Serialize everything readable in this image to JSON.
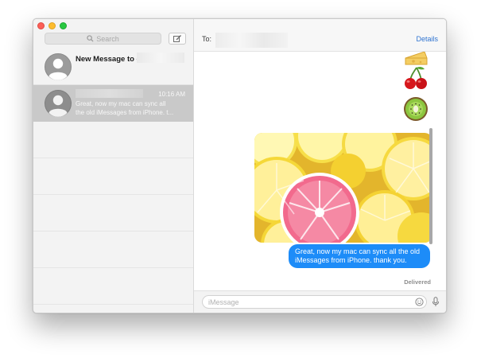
{
  "sidebar": {
    "search_placeholder": "Search",
    "conversations": [
      {
        "name": "New Message to -",
        "time": "",
        "preview": ""
      },
      {
        "name": "",
        "time": "10:16 AM",
        "preview": "Great, now my mac can sync all\nthe old iMessages from iPhone. t..."
      }
    ]
  },
  "header": {
    "to_label": "To:",
    "details_label": "Details"
  },
  "transcript": {
    "emojis": [
      "cheese-icon",
      "cherry-icon",
      "kiwi-icon"
    ],
    "message_text": "Great, now my mac can sync all the old iMessages from iPhone. thank you.",
    "status": "Delivered"
  },
  "input": {
    "placeholder": "iMessage"
  },
  "colors": {
    "bubble": "#1d8cf8",
    "accent": "#2f74d1",
    "selected_row": "#c9c9c9"
  }
}
